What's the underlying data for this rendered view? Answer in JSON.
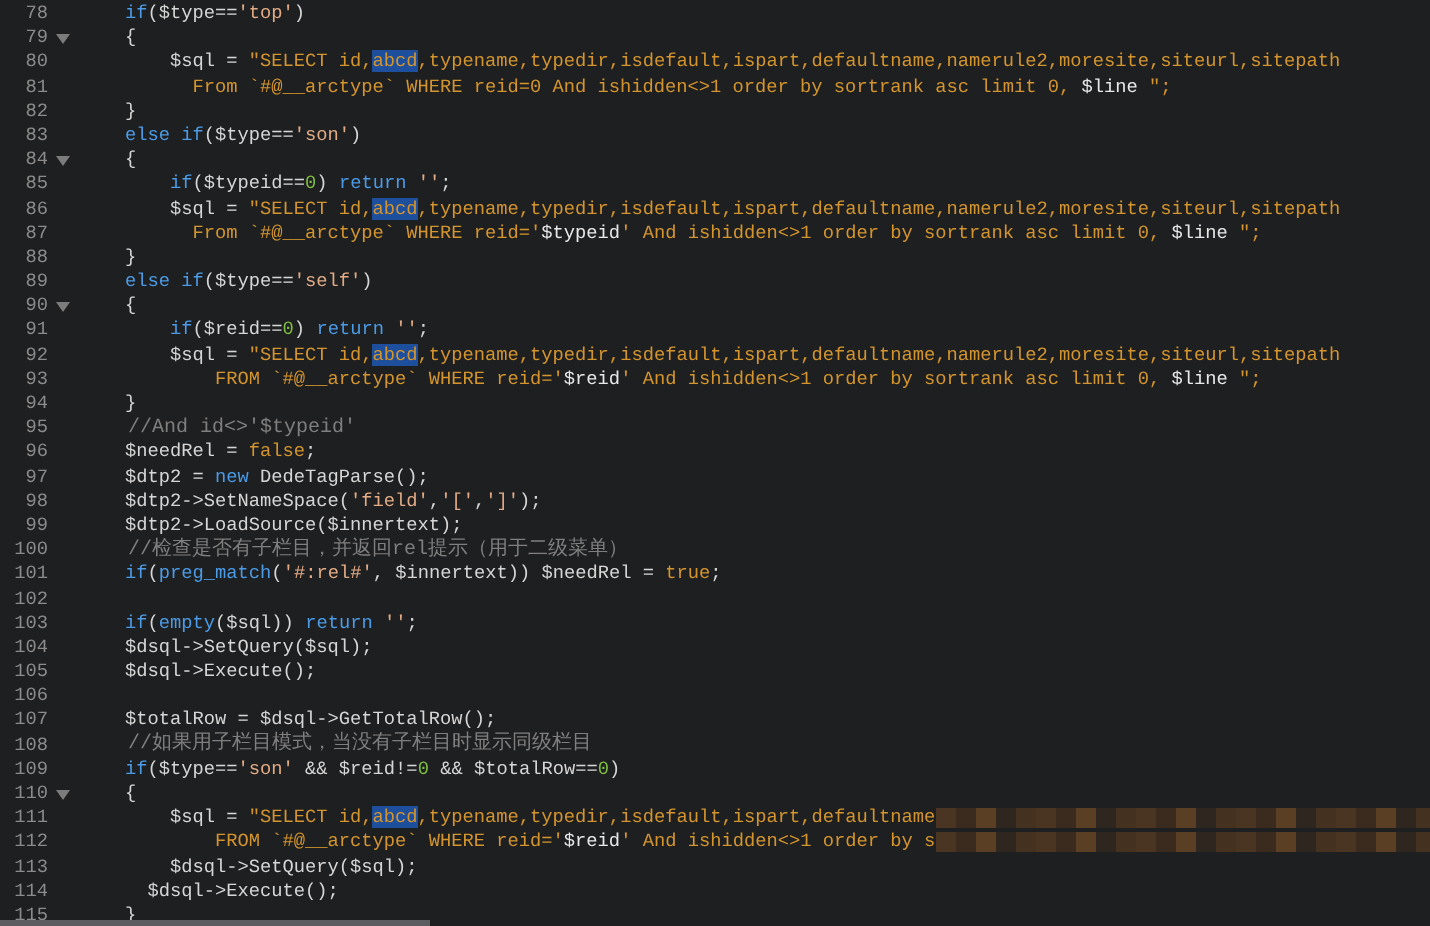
{
  "editor": {
    "lines": [
      {
        "number": "78",
        "foldable": false,
        "redacted": false,
        "tokens": [
          {
            "kind": "keyword",
            "text": "    if"
          },
          {
            "kind": "plain",
            "text": "($type=="
          },
          {
            "kind": "string",
            "text": "'top'"
          },
          {
            "kind": "plain",
            "text": ")"
          }
        ]
      },
      {
        "number": "79",
        "foldable": true,
        "redacted": false,
        "tokens": [
          {
            "kind": "plain",
            "text": "    {"
          }
        ]
      },
      {
        "number": "80",
        "foldable": false,
        "redacted": false,
        "tokens": [
          {
            "kind": "plain",
            "text": "        $sql = "
          },
          {
            "kind": "sqlstring",
            "text": "\"SELECT id,"
          },
          {
            "kind": "match",
            "text": "abcd"
          },
          {
            "kind": "sqlstring",
            "text": ",typename,typedir,isdefault,ispart,defaultname,namerule2,moresite,siteurl,sitepath"
          }
        ]
      },
      {
        "number": "81",
        "foldable": false,
        "redacted": false,
        "tokens": [
          {
            "kind": "sqlstring",
            "text": "          From `#@__arctype` WHERE reid=0 And ishidden<>1 order by sortrank asc limit 0, "
          },
          {
            "kind": "variable",
            "text": "$line"
          },
          {
            "kind": "sqlstring",
            "text": " \";"
          }
        ]
      },
      {
        "number": "82",
        "foldable": false,
        "redacted": false,
        "tokens": [
          {
            "kind": "plain",
            "text": "    }"
          }
        ]
      },
      {
        "number": "83",
        "foldable": false,
        "redacted": false,
        "tokens": [
          {
            "kind": "keyword",
            "text": "    else if"
          },
          {
            "kind": "plain",
            "text": "($type=="
          },
          {
            "kind": "string",
            "text": "'son'"
          },
          {
            "kind": "plain",
            "text": ")"
          }
        ]
      },
      {
        "number": "84",
        "foldable": true,
        "redacted": false,
        "tokens": [
          {
            "kind": "plain",
            "text": "    {"
          }
        ]
      },
      {
        "number": "85",
        "foldable": false,
        "redacted": false,
        "tokens": [
          {
            "kind": "keyword",
            "text": "        if"
          },
          {
            "kind": "plain",
            "text": "($typeid=="
          },
          {
            "kind": "number",
            "text": "0"
          },
          {
            "kind": "plain",
            "text": ") "
          },
          {
            "kind": "keyword",
            "text": "return"
          },
          {
            "kind": "string",
            "text": " ''"
          },
          {
            "kind": "plain",
            "text": ";"
          }
        ]
      },
      {
        "number": "86",
        "foldable": false,
        "redacted": false,
        "tokens": [
          {
            "kind": "plain",
            "text": "        $sql = "
          },
          {
            "kind": "sqlstring",
            "text": "\"SELECT id,"
          },
          {
            "kind": "match",
            "text": "abcd"
          },
          {
            "kind": "sqlstring",
            "text": ",typename,typedir,isdefault,ispart,defaultname,namerule2,moresite,siteurl,sitepath"
          }
        ]
      },
      {
        "number": "87",
        "foldable": false,
        "redacted": false,
        "tokens": [
          {
            "kind": "sqlstring",
            "text": "          From `#@__arctype` WHERE reid='"
          },
          {
            "kind": "variable",
            "text": "$typeid"
          },
          {
            "kind": "sqlstring",
            "text": "' And ishidden<>1 order by sortrank asc limit 0, "
          },
          {
            "kind": "variable",
            "text": "$line"
          },
          {
            "kind": "sqlstring",
            "text": " \";"
          }
        ]
      },
      {
        "number": "88",
        "foldable": false,
        "redacted": false,
        "tokens": [
          {
            "kind": "plain",
            "text": "    }"
          }
        ]
      },
      {
        "number": "89",
        "foldable": false,
        "redacted": false,
        "tokens": [
          {
            "kind": "keyword",
            "text": "    else if"
          },
          {
            "kind": "plain",
            "text": "($type=="
          },
          {
            "kind": "string",
            "text": "'self'"
          },
          {
            "kind": "plain",
            "text": ")"
          }
        ]
      },
      {
        "number": "90",
        "foldable": true,
        "redacted": false,
        "tokens": [
          {
            "kind": "plain",
            "text": "    {"
          }
        ]
      },
      {
        "number": "91",
        "foldable": false,
        "redacted": false,
        "tokens": [
          {
            "kind": "keyword",
            "text": "        if"
          },
          {
            "kind": "plain",
            "text": "($reid=="
          },
          {
            "kind": "number",
            "text": "0"
          },
          {
            "kind": "plain",
            "text": ") "
          },
          {
            "kind": "keyword",
            "text": "return"
          },
          {
            "kind": "string",
            "text": " ''"
          },
          {
            "kind": "plain",
            "text": ";"
          }
        ]
      },
      {
        "number": "92",
        "foldable": false,
        "redacted": false,
        "tokens": [
          {
            "kind": "plain",
            "text": "        $sql = "
          },
          {
            "kind": "sqlstring",
            "text": "\"SELECT id,"
          },
          {
            "kind": "match",
            "text": "abcd"
          },
          {
            "kind": "sqlstring",
            "text": ",typename,typedir,isdefault,ispart,defaultname,namerule2,moresite,siteurl,sitepath"
          }
        ]
      },
      {
        "number": "93",
        "foldable": false,
        "redacted": false,
        "tokens": [
          {
            "kind": "sqlstring",
            "text": "            FROM `#@__arctype` WHERE reid='"
          },
          {
            "kind": "variable",
            "text": "$reid"
          },
          {
            "kind": "sqlstring",
            "text": "' And ishidden<>1 order by sortrank asc limit 0, "
          },
          {
            "kind": "variable",
            "text": "$line"
          },
          {
            "kind": "sqlstring",
            "text": " \";"
          }
        ]
      },
      {
        "number": "94",
        "foldable": false,
        "redacted": false,
        "tokens": [
          {
            "kind": "plain",
            "text": "    }"
          }
        ]
      },
      {
        "number": "95",
        "foldable": false,
        "redacted": false,
        "tokens": [
          {
            "kind": "comment",
            "text": "    //And id<>'$typeid'"
          }
        ]
      },
      {
        "number": "96",
        "foldable": false,
        "redacted": false,
        "tokens": [
          {
            "kind": "plain",
            "text": "    $needRel = "
          },
          {
            "kind": "constant",
            "text": "false"
          },
          {
            "kind": "plain",
            "text": ";"
          }
        ]
      },
      {
        "number": "97",
        "foldable": false,
        "redacted": false,
        "tokens": [
          {
            "kind": "plain",
            "text": "    $dtp2 = "
          },
          {
            "kind": "keyword",
            "text": "new"
          },
          {
            "kind": "plain",
            "text": " DedeTagParse();"
          }
        ]
      },
      {
        "number": "98",
        "foldable": false,
        "redacted": false,
        "tokens": [
          {
            "kind": "plain",
            "text": "    $dtp2->SetNameSpace("
          },
          {
            "kind": "string",
            "text": "'field'"
          },
          {
            "kind": "plain",
            "text": ","
          },
          {
            "kind": "string",
            "text": "'['"
          },
          {
            "kind": "plain",
            "text": ","
          },
          {
            "kind": "string",
            "text": "']'"
          },
          {
            "kind": "plain",
            "text": ");"
          }
        ]
      },
      {
        "number": "99",
        "foldable": false,
        "redacted": false,
        "tokens": [
          {
            "kind": "plain",
            "text": "    $dtp2->LoadSource($innertext);"
          }
        ]
      },
      {
        "number": "100",
        "foldable": false,
        "redacted": false,
        "tokens": [
          {
            "kind": "comment",
            "text": "    //检查是否有子栏目，并返回rel提示（用于二级菜单）"
          }
        ]
      },
      {
        "number": "101",
        "foldable": false,
        "redacted": false,
        "tokens": [
          {
            "kind": "keyword",
            "text": "    if"
          },
          {
            "kind": "plain",
            "text": "("
          },
          {
            "kind": "keyword",
            "text": "preg_match"
          },
          {
            "kind": "plain",
            "text": "("
          },
          {
            "kind": "string",
            "text": "'#:rel#'"
          },
          {
            "kind": "plain",
            "text": ", $innertext)) $needRel = "
          },
          {
            "kind": "constant",
            "text": "true"
          },
          {
            "kind": "plain",
            "text": ";"
          }
        ]
      },
      {
        "number": "102",
        "foldable": false,
        "redacted": false
      },
      {
        "number": "103",
        "foldable": false,
        "redacted": false,
        "tokens": [
          {
            "kind": "keyword",
            "text": "    if"
          },
          {
            "kind": "plain",
            "text": "("
          },
          {
            "kind": "keyword",
            "text": "empty"
          },
          {
            "kind": "plain",
            "text": "($sql)) "
          },
          {
            "kind": "keyword",
            "text": "return"
          },
          {
            "kind": "string",
            "text": " ''"
          },
          {
            "kind": "plain",
            "text": ";"
          }
        ]
      },
      {
        "number": "104",
        "foldable": false,
        "redacted": false,
        "tokens": [
          {
            "kind": "plain",
            "text": "    $dsql->SetQuery($sql);"
          }
        ]
      },
      {
        "number": "105",
        "foldable": false,
        "redacted": false,
        "tokens": [
          {
            "kind": "plain",
            "text": "    $dsql->Execute();"
          }
        ]
      },
      {
        "number": "106",
        "foldable": false,
        "redacted": false
      },
      {
        "number": "107",
        "foldable": false,
        "redacted": false,
        "tokens": [
          {
            "kind": "plain",
            "text": "    $totalRow = $dsql->GetTotalRow();"
          }
        ]
      },
      {
        "number": "108",
        "foldable": false,
        "redacted": false,
        "tokens": [
          {
            "kind": "comment",
            "text": "    //如果用子栏目模式，当没有子栏目时显示同级栏目"
          }
        ]
      },
      {
        "number": "109",
        "foldable": false,
        "redacted": false,
        "tokens": [
          {
            "kind": "keyword",
            "text": "    if"
          },
          {
            "kind": "plain",
            "text": "($type=="
          },
          {
            "kind": "string",
            "text": "'son'"
          },
          {
            "kind": "plain",
            "text": " && $reid!="
          },
          {
            "kind": "number",
            "text": "0"
          },
          {
            "kind": "plain",
            "text": " && $totalRow=="
          },
          {
            "kind": "number",
            "text": "0"
          },
          {
            "kind": "plain",
            "text": ")"
          }
        ]
      },
      {
        "number": "110",
        "foldable": true,
        "redacted": false,
        "tokens": [
          {
            "kind": "plain",
            "text": "    {"
          }
        ]
      },
      {
        "number": "111",
        "foldable": false,
        "redacted": true,
        "tokens": [
          {
            "kind": "plain",
            "text": "        $sql = "
          },
          {
            "kind": "sqlstring",
            "text": "\"SELECT id,"
          },
          {
            "kind": "match",
            "text": "abcd"
          },
          {
            "kind": "sqlstring",
            "text": ",typename,typedir,isdefault,ispart,defaultname"
          }
        ]
      },
      {
        "number": "112",
        "foldable": false,
        "redacted": true,
        "tokens": [
          {
            "kind": "sqlstring",
            "text": "            FROM `#@__arctype` WHERE reid='"
          },
          {
            "kind": "variable",
            "text": "$reid"
          },
          {
            "kind": "sqlstring",
            "text": "' And ishidden<>1 order by s"
          }
        ]
      },
      {
        "number": "113",
        "foldable": false,
        "redacted": false,
        "tokens": [
          {
            "kind": "plain",
            "text": "        $dsql->SetQuery($sql);"
          }
        ]
      },
      {
        "number": "114",
        "foldable": false,
        "redacted": false,
        "tokens": [
          {
            "kind": "plain",
            "text": "      $dsql->Execute();"
          }
        ]
      },
      {
        "number": "115",
        "foldable": false,
        "redacted": false,
        "tokens": [
          {
            "kind": "plain",
            "text": "    }"
          }
        ]
      }
    ]
  }
}
